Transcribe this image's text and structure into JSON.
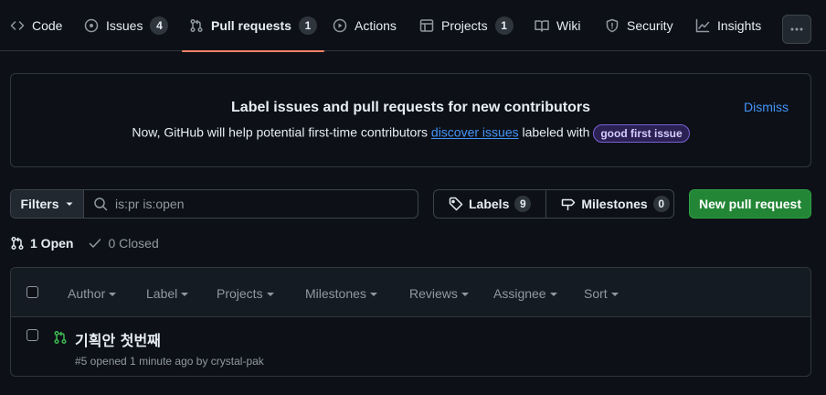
{
  "nav": {
    "tabs": [
      {
        "label": "Code",
        "icon": "code-icon"
      },
      {
        "label": "Issues",
        "icon": "issue-opened-icon",
        "count": "4"
      },
      {
        "label": "Pull requests",
        "icon": "git-pull-request-icon",
        "count": "1",
        "active": true
      },
      {
        "label": "Actions",
        "icon": "play-icon"
      },
      {
        "label": "Projects",
        "icon": "table-icon",
        "count": "1"
      },
      {
        "label": "Wiki",
        "icon": "book-icon"
      },
      {
        "label": "Security",
        "icon": "shield-icon"
      },
      {
        "label": "Insights",
        "icon": "graph-icon"
      }
    ],
    "more_icon": "kebab-horizontal-icon"
  },
  "banner": {
    "title": "Label issues and pull requests for new contributors",
    "text_before": "Now, GitHub will help potential first-time contributors",
    "link": "discover issues",
    "text_after": "labeled with",
    "label": "good first issue",
    "dismiss": "Dismiss"
  },
  "toolbar": {
    "filters_label": "Filters",
    "search_value": "is:pr is:open",
    "labels_label": "Labels",
    "labels_count": "9",
    "milestones_label": "Milestones",
    "milestones_count": "0",
    "new_pr_label": "New pull request"
  },
  "states": {
    "open": "1 Open",
    "closed": "0 Closed"
  },
  "list": {
    "header_filters": [
      "Author",
      "Label",
      "Projects",
      "Milestones",
      "Reviews",
      "Assignee",
      "Sort"
    ],
    "items": [
      {
        "title": "기획안 첫번째",
        "meta": "#5 opened 1 minute ago by crystal-pak"
      }
    ]
  },
  "colors": {
    "background": "#0d1117",
    "accent_tab": "#f78166",
    "link": "#4493f8",
    "primary_button": "#238636",
    "open_icon": "#3fb950",
    "label_bg": "#2b2253"
  }
}
